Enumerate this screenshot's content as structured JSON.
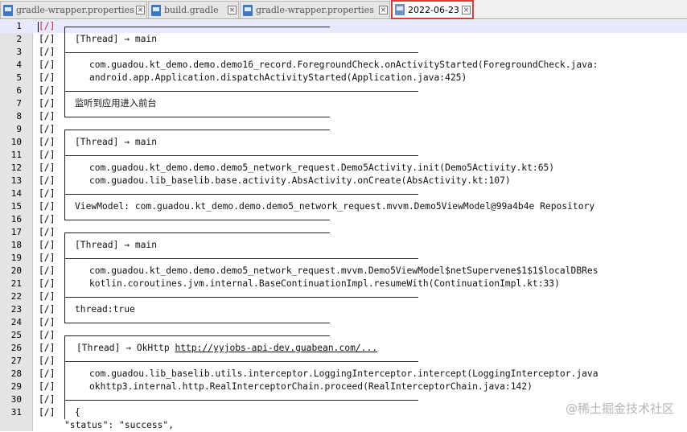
{
  "tabs": [
    {
      "label": "gradle-wrapper.properties",
      "active": false,
      "icon": "document-icon"
    },
    {
      "label": "build.gradle",
      "active": false,
      "icon": "document-icon"
    },
    {
      "label": "gradle-wrapper.properties",
      "active": false,
      "icon": "document-icon"
    },
    {
      "label": "2022-06-23",
      "active": true,
      "icon": "document-icon"
    }
  ],
  "close_glyph": "×",
  "lines": [
    {
      "n": "1",
      "tag": "[/]",
      "kind": "top"
    },
    {
      "n": "2",
      "tag": "[/]",
      "kind": "text",
      "text": "[Thread] → main"
    },
    {
      "n": "3",
      "tag": "[/]",
      "kind": "mid"
    },
    {
      "n": "4",
      "tag": "[/]",
      "kind": "stack",
      "text": "com.guadou.kt_demo.demo.demo16_record.ForegroundCheck.onActivityStarted(ForegroundCheck.java:"
    },
    {
      "n": "5",
      "tag": "[/]",
      "kind": "stack",
      "text": "android.app.Application.dispatchActivityStarted(Application.java:425)"
    },
    {
      "n": "6",
      "tag": "[/]",
      "kind": "mid"
    },
    {
      "n": "7",
      "tag": "[/]",
      "kind": "text",
      "text": "监听到应用进入前台"
    },
    {
      "n": "8",
      "tag": "[/]",
      "kind": "bottom"
    },
    {
      "n": "9",
      "tag": "[/]",
      "kind": "top"
    },
    {
      "n": "10",
      "tag": "[/]",
      "kind": "text",
      "text": "[Thread] → main"
    },
    {
      "n": "11",
      "tag": "[/]",
      "kind": "mid"
    },
    {
      "n": "12",
      "tag": "[/]",
      "kind": "stack",
      "text": "com.guadou.kt_demo.demo.demo5_network_request.Demo5Activity.init(Demo5Activity.kt:65)"
    },
    {
      "n": "13",
      "tag": "[/]",
      "kind": "stack",
      "text": "com.guadou.lib_baselib.base.activity.AbsActivity.onCreate(AbsActivity.kt:107)"
    },
    {
      "n": "14",
      "tag": "[/]",
      "kind": "mid"
    },
    {
      "n": "15",
      "tag": "[/]",
      "kind": "text",
      "text": "ViewModel: com.guadou.kt_demo.demo.demo5_network_request.mvvm.Demo5ViewModel@99a4b4e Repository"
    },
    {
      "n": "16",
      "tag": "[/]",
      "kind": "bottom"
    },
    {
      "n": "17",
      "tag": "[/]",
      "kind": "top"
    },
    {
      "n": "18",
      "tag": "[/]",
      "kind": "text",
      "text": "[Thread] → main"
    },
    {
      "n": "19",
      "tag": "[/]",
      "kind": "mid"
    },
    {
      "n": "20",
      "tag": "[/]",
      "kind": "stack",
      "text": "com.guadou.kt_demo.demo.demo5_network_request.mvvm.Demo5ViewModel$netSupervene$1$1$localDBRes"
    },
    {
      "n": "21",
      "tag": "[/]",
      "kind": "stack",
      "text": "kotlin.coroutines.jvm.internal.BaseContinuationImpl.resumeWith(ContinuationImpl.kt:33)"
    },
    {
      "n": "22",
      "tag": "[/]",
      "kind": "mid"
    },
    {
      "n": "23",
      "tag": "[/]",
      "kind": "text",
      "text": "thread:true"
    },
    {
      "n": "24",
      "tag": "[/]",
      "kind": "bottom"
    },
    {
      "n": "25",
      "tag": "[/]",
      "kind": "top"
    },
    {
      "n": "26",
      "tag": "[/]",
      "kind": "thread-link",
      "text": "[Thread] → OkHttp ",
      "link": "http://yyjobs-api-dev.guabean.com/..."
    },
    {
      "n": "27",
      "tag": "[/]",
      "kind": "mid"
    },
    {
      "n": "28",
      "tag": "[/]",
      "kind": "stack",
      "text": "com.guadou.lib_baselib.utils.interceptor.LoggingInterceptor.intercept(LoggingInterceptor.java"
    },
    {
      "n": "29",
      "tag": "[/]",
      "kind": "stack",
      "text": "okhttp3.internal.http.RealInterceptorChain.proceed(RealInterceptorChain.java:142)"
    },
    {
      "n": "30",
      "tag": "[/]",
      "kind": "mid"
    },
    {
      "n": "31",
      "tag": "[/]",
      "kind": "text",
      "text": "{"
    },
    {
      "n": "",
      "tag": "",
      "kind": "raw",
      "text": "\"status\": \"success\","
    }
  ],
  "watermark": "@稀土掘金技术社区"
}
